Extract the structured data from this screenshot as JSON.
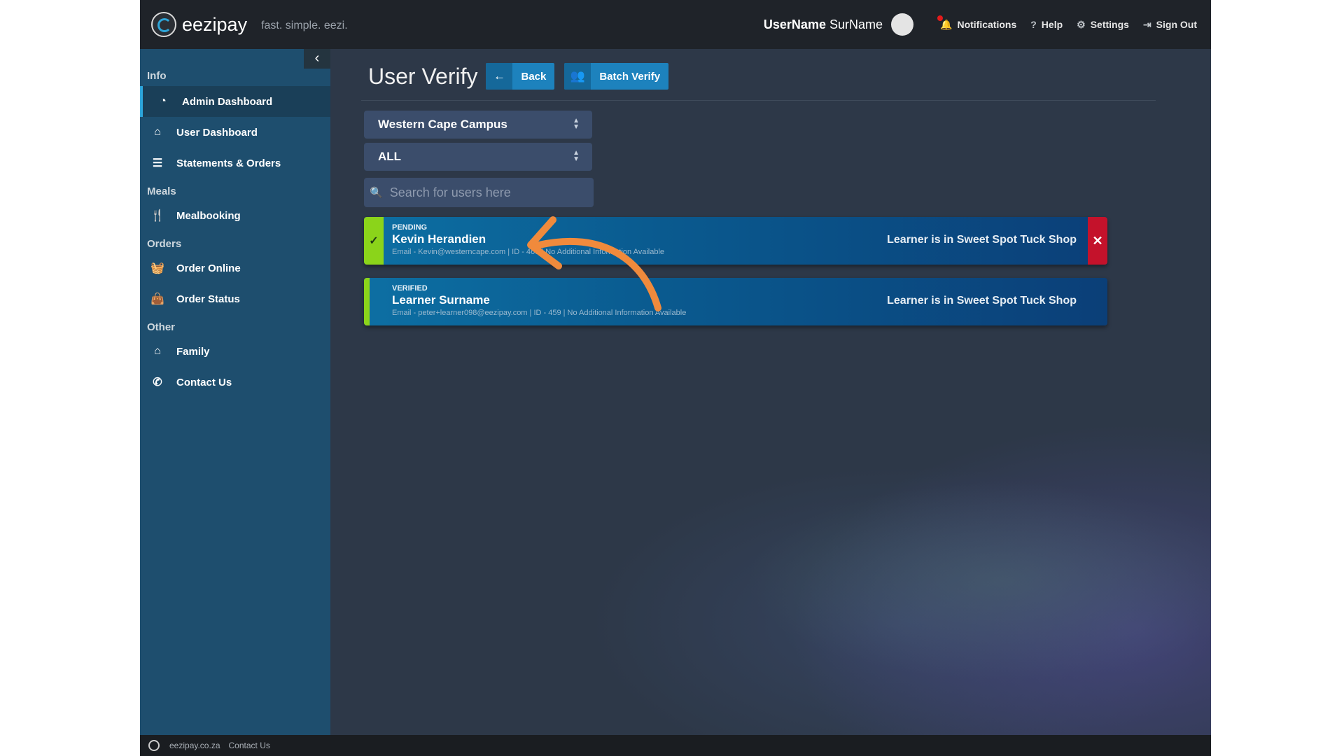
{
  "brand": {
    "name": "eezipay",
    "tagline": "fast. simple. eezi."
  },
  "topbar": {
    "user_first": "UserName",
    "user_last": "SurName",
    "notifications": "Notifications",
    "help": "Help",
    "settings": "Settings",
    "sign_out": "Sign Out"
  },
  "sidebar": {
    "collapse_icon": "‹",
    "sections": {
      "info": "Info",
      "meals": "Meals",
      "orders": "Orders",
      "other": "Other"
    },
    "items": {
      "admin_dashboard": "Admin Dashboard",
      "user_dashboard": "User Dashboard",
      "statements": "Statements & Orders",
      "mealbooking": "Mealbooking",
      "order_online": "Order Online",
      "order_status": "Order Status",
      "family": "Family",
      "contact_us": "Contact Us"
    }
  },
  "main": {
    "title": "User Verify",
    "back_label": "Back",
    "batch_verify_label": "Batch Verify",
    "campus_select": "Western Cape Campus",
    "status_select": "ALL",
    "search_placeholder": "Search for users here"
  },
  "users": [
    {
      "status": "PENDING",
      "name": "Kevin Herandien",
      "details": "Email - Kevin@westerncape.com | ID - 460 | No Additional Information Available",
      "location": "Learner is in Sweet Spot Tuck Shop"
    },
    {
      "status": "VERIFIED",
      "name": "Learner Surname",
      "details": "Email - peter+learner098@eezipay.com | ID - 459 | No Additional Information Available",
      "location": "Learner is in Sweet Spot Tuck Shop"
    }
  ],
  "footer": {
    "site": "eezipay.co.za",
    "contact": "Contact Us"
  },
  "colors": {
    "accent": "#1d82bd",
    "pending_strip": "#8bd41a",
    "remove": "#c4122b",
    "annotation_arrow": "#f08a3c"
  }
}
